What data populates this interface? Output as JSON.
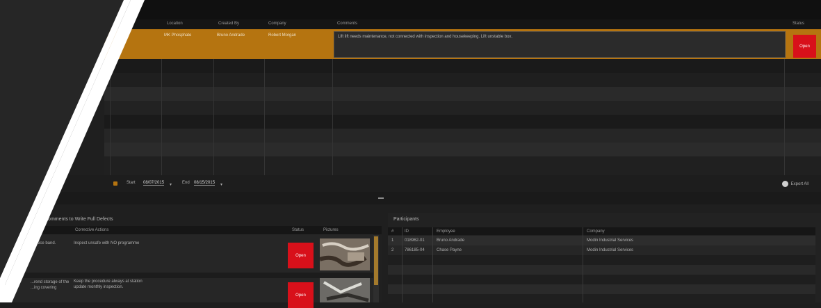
{
  "table": {
    "columns": [
      "Location",
      "Created By",
      "Company",
      "Comments",
      "Status"
    ],
    "selected_row": {
      "cells": [
        "...",
        "MK Phosphate",
        "Bruno Andrade",
        "Robert Morgan"
      ],
      "comment": "Lift lift needs maintenance, not connected with inspection and housekeeping. Lift unstable box.",
      "status": "Open"
    }
  },
  "date_filter": {
    "start_label": "Start",
    "start_value": "08/07/2015",
    "end_label": "End",
    "end_value": "08/15/2015",
    "export_label": "Export All"
  },
  "issues_panel": {
    "title": "Comments to Write Full Defects",
    "columns": [
      "Corrective Actions",
      "Status",
      "Pictures"
    ],
    "rows": [
      {
        "left_fragment": "...rotice band.",
        "action": "Inspect unsafe with NO programme",
        "status": "Open"
      },
      {
        "left_fragment": "...rend storage of the ...ing covering",
        "action": "Keep the procedure always at station",
        "action_line2": "update monthly inspection.",
        "status": "Open"
      }
    ]
  },
  "participants_panel": {
    "title": "Participants",
    "columns": [
      "#",
      "ID",
      "Employee",
      "Company"
    ],
    "rows": [
      {
        "num": "1",
        "id": "018962-01",
        "employee": "Bruno Andrade",
        "company": "Modin Industrial Services"
      },
      {
        "num": "2",
        "id": "786185-04",
        "employee": "Chase Payne",
        "company": "Modin Industrial Services"
      }
    ]
  },
  "colors": {
    "accent": "#b57410",
    "status_open": "#d8101a",
    "background": "#1f1f1f"
  },
  "icons": [
    "calendar-icon",
    "export-icon",
    "splitter-grip-icon"
  ]
}
